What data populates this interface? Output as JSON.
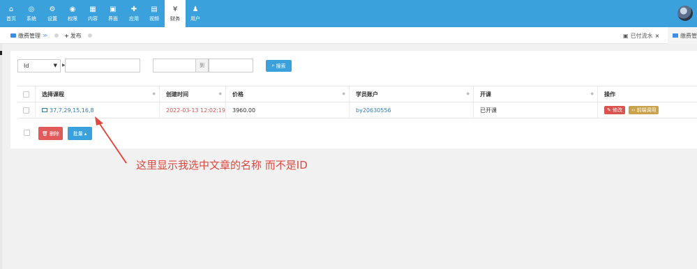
{
  "nav": [
    {
      "icon": "home-icon",
      "glyph": "⌂",
      "label": "首页"
    },
    {
      "icon": "globe-icon",
      "glyph": "◎",
      "label": "系统"
    },
    {
      "icon": "cogs-icon",
      "glyph": "⚙",
      "label": "设置"
    },
    {
      "icon": "user-circle-icon",
      "glyph": "◉",
      "label": "权限"
    },
    {
      "icon": "grid-icon",
      "glyph": "▦",
      "label": "内容"
    },
    {
      "icon": "html5-icon",
      "glyph": "▣",
      "label": "界面"
    },
    {
      "icon": "puzzle-icon",
      "glyph": "✚",
      "label": "应用"
    },
    {
      "icon": "file-video-icon",
      "glyph": "▤",
      "label": "视频"
    },
    {
      "icon": "yen-icon",
      "glyph": "¥",
      "label": "财务"
    },
    {
      "icon": "user-icon",
      "glyph": "♟",
      "label": "用户"
    }
  ],
  "subbar": {
    "crumb1": "缴费管理",
    "crumb2": "发布",
    "tab_paid": "已付流水",
    "tab_active": "缴费管"
  },
  "filter": {
    "field_select": "Id",
    "range_to": "到",
    "search_label": "搜索"
  },
  "table": {
    "headers": [
      "选择课程",
      "创建时间",
      "价格",
      "学员账户",
      "开课",
      "操作"
    ],
    "row": {
      "course": "37,7,29,15,16,8",
      "created": "2022-03-13 12:02:19",
      "price": "3960.00",
      "account": "by20630556",
      "status": "已开课",
      "edit": "修改",
      "call": "前端调用"
    }
  },
  "actions": {
    "delete": "删除",
    "batch": "批量"
  },
  "annotation": "这里显示我选中文章的名称  而不是ID",
  "colors": {
    "primary": "#3ba1dd",
    "danger": "#d9534f",
    "annotation": "#e2483d"
  }
}
